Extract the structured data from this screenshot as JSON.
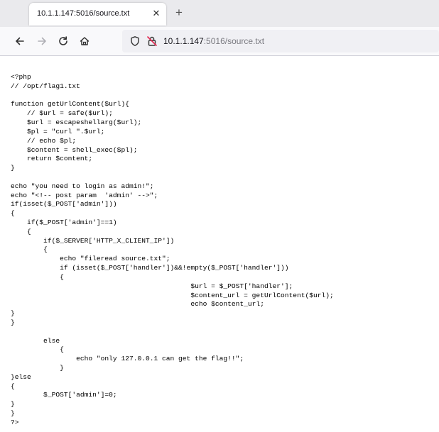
{
  "tab": {
    "title": "10.1.1.147:5016/source.txt",
    "close_icon": "close-icon",
    "new_tab_icon": "plus-icon"
  },
  "toolbar": {
    "back_icon": "arrow-left-icon",
    "forward_icon": "arrow-right-icon",
    "reload_icon": "reload-icon",
    "home_icon": "home-icon"
  },
  "address_bar": {
    "host": "10.1.1.147",
    "path": ":5016/source.txt",
    "shield_icon": "shield-icon",
    "lock_icon": "insecure-lock-icon"
  },
  "page": {
    "source": "<?php\n// /opt/flag1.txt\n\nfunction getUrlContent($url){\n    // $url = safe($url);\n    $url = escapeshellarg($url);\n    $pl = \"curl \".$url;\n    // echo $pl;\n    $content = shell_exec($pl);\n    return $content;\n}\n\necho \"you need to login as admin!\";\necho \"<!-- post param  'admin' -->\";\nif(isset($_POST['admin']))\n{\n    if($_POST['admin']==1)\n    {\n        if($_SERVER['HTTP_X_CLIENT_IP'])\n        {\n            echo \"fileread source.txt\";\n            if (isset($_POST['handler'])&&!empty($_POST['handler']))\n            {\n                                            $url = $_POST['handler'];\n                                            $content_url = getUrlContent($url);\n                                            echo $content_url;\n}\n}\n\n        else\n            {\n                echo \"only 127.0.0.1 can get the flag!!\";\n            }\n}else\n{\n        $_POST['admin']=0;\n}\n}\n?>"
  },
  "colors": {
    "tabbar_bg": "#eaeaed",
    "navbar_bg": "#f9f9fb",
    "urlbar_bg": "#f0f0f4",
    "text": "#15141a",
    "url_path": "#7a7a80"
  }
}
